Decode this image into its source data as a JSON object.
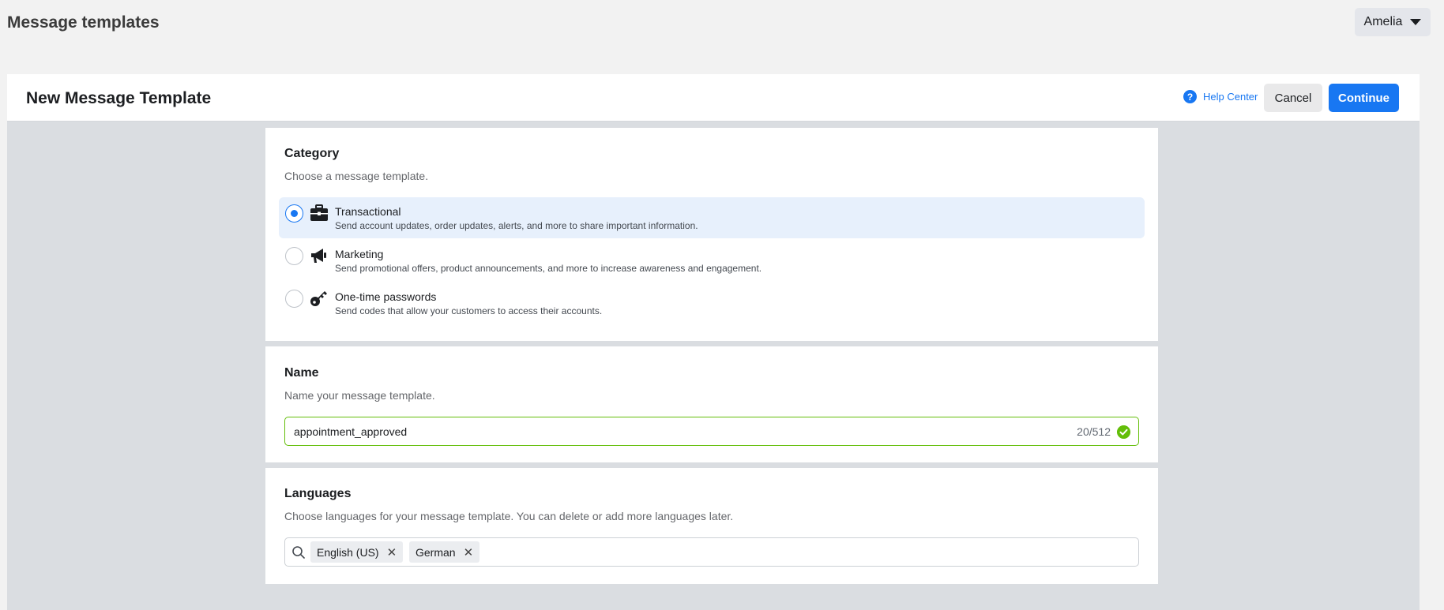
{
  "page": {
    "title": "Message templates"
  },
  "user": {
    "name": "Amelia"
  },
  "header": {
    "title": "New Message Template",
    "help_label": "Help Center",
    "cancel_label": "Cancel",
    "continue_label": "Continue"
  },
  "category": {
    "title": "Category",
    "subtitle": "Choose a message template.",
    "options": [
      {
        "label": "Transactional",
        "description": "Send account updates, order updates, alerts, and more to share important information.",
        "icon": "briefcase-icon",
        "selected": true
      },
      {
        "label": "Marketing",
        "description": "Send promotional offers, product announcements, and more to increase awareness and engagement.",
        "icon": "megaphone-icon",
        "selected": false
      },
      {
        "label": "One-time passwords",
        "description": "Send codes that allow your customers to access their accounts.",
        "icon": "key-icon",
        "selected": false
      }
    ]
  },
  "name": {
    "title": "Name",
    "subtitle": "Name your message template.",
    "value": "appointment_approved",
    "char_count": "20/512"
  },
  "languages": {
    "title": "Languages",
    "subtitle": "Choose languages for your message template. You can delete or add more languages later.",
    "tags": [
      "English (US)",
      "German"
    ]
  },
  "colors": {
    "accent": "#1877f2",
    "success": "#63be09",
    "selected_bg": "#e7f0fc"
  }
}
